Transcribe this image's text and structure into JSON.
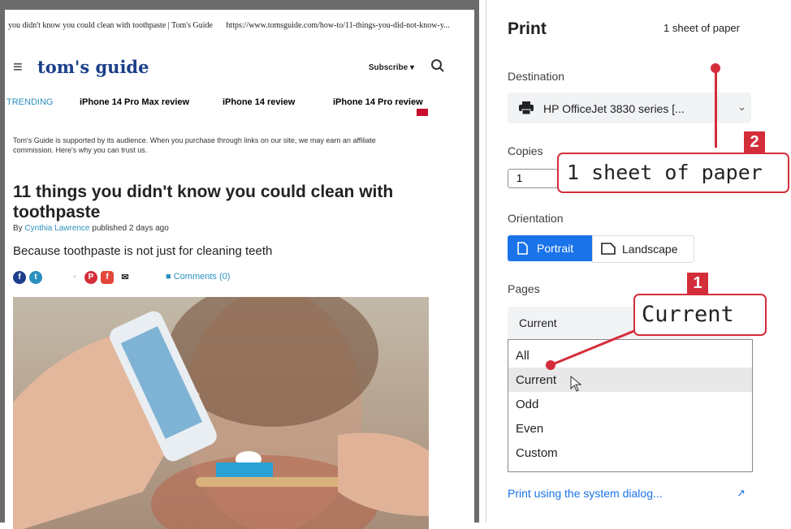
{
  "preview": {
    "header_title": "you didn't know you could clean with toothpaste | Tom's Guide",
    "header_url": "https://www.tomsguide.com/how-to/11-things-you-did-not-know-y...",
    "logo": "tom's guide",
    "subscribe": "Subscribe ▾",
    "trending_label": "TRENDING",
    "trending": [
      "iPhone 14 Pro Max review",
      "iPhone 14 review",
      "iPhone 14 Pro review"
    ],
    "notice": "Tom's Guide is supported by its audience. When you purchase through links on our site, we may earn an affiliate commission. Here's why you can trust us.",
    "headline": "11 things you didn't know you could clean with toothpaste",
    "byline_prefix": "By",
    "author": "Cynthia Lawrence",
    "published": "published 2 days ago",
    "dek": "Because toothpaste is not just for cleaning teeth",
    "comments": "Comments (0)"
  },
  "print_panel": {
    "title": "Print",
    "sheets": "1 sheet of paper",
    "destination_label": "Destination",
    "destination_value": "HP OfficeJet 3830 series [...",
    "copies_label": "Copies",
    "copies_value": "1",
    "orientation_label": "Orientation",
    "portrait": "Portrait",
    "landscape": "Landscape",
    "pages_label": "Pages",
    "pages_selected": "Current",
    "pages_options": [
      "All",
      "Current",
      "Odd",
      "Even",
      "Custom"
    ],
    "system_dialog": "Print using the system dialog..."
  },
  "callouts": {
    "one": {
      "badge": "1",
      "text": "Current"
    },
    "two": {
      "badge": "2",
      "text": "1 sheet of paper"
    }
  },
  "colors": {
    "accent": "#1a73e8",
    "callout_red": "#d42d3a",
    "brand_blue": "#1b3f8a"
  }
}
